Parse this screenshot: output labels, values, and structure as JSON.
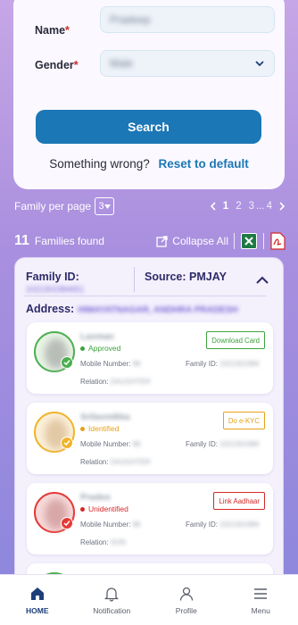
{
  "form": {
    "name_label": "Name",
    "name_value": "Pradeep",
    "gender_label": "Gender",
    "gender_value": "Male",
    "required_mark": "*",
    "search_label": "Search",
    "wrong_text": "Something wrong?",
    "reset_label": "Reset to default"
  },
  "pager": {
    "per_page_label": "Family per page",
    "per_page_value": "3",
    "pages": [
      "1",
      "2",
      "3",
      "...",
      "4"
    ],
    "current_page": "1"
  },
  "results": {
    "count": "11",
    "found_label": "Families found",
    "collapse_label": "Collapse All"
  },
  "family": {
    "id_label": "Family ID:",
    "id_value": "1021301984651",
    "source_label": "Source: PMJAY",
    "address_label": "Address:",
    "address_value": "HIMAYATNAGAR, ANDHRA PRADESH",
    "members": [
      {
        "name": "Laxman",
        "status": "Approved",
        "status_color": "#3ea33e",
        "action": "Download Card",
        "action_color": "#3ea33e",
        "mobile_label": "Mobile Number:",
        "mobile_value": "98",
        "fid_label": "Family ID:",
        "fid_value": "1021301984",
        "relation_label": "Relation:",
        "relation_value": "DAUGHTER",
        "ring_color": "#4caf50"
      },
      {
        "name": "Srilaxmikka",
        "status": "Identified",
        "status_color": "#e6a21a",
        "action": "Do e-KYC",
        "action_color": "#e6a21a",
        "mobile_label": "Mobile Number:",
        "mobile_value": "98",
        "fid_label": "Family ID:",
        "fid_value": "1021301984",
        "relation_label": "Relation:",
        "relation_value": "DAUGHTER",
        "ring_color": "#f0b429"
      },
      {
        "name": "Pradeo",
        "status": "Unidentified",
        "status_color": "#d62828",
        "action": "Link Aadhaar",
        "action_color": "#d62828",
        "mobile_label": "Mobile Number:",
        "mobile_value": "98",
        "fid_label": "Family ID:",
        "fid_value": "1021301984",
        "relation_label": "Relation:",
        "relation_value": "SON",
        "ring_color": "#e53935"
      }
    ]
  },
  "nav": {
    "home": "HOME",
    "notification": "Notification",
    "profile": "Profile",
    "menu": "Menu"
  }
}
